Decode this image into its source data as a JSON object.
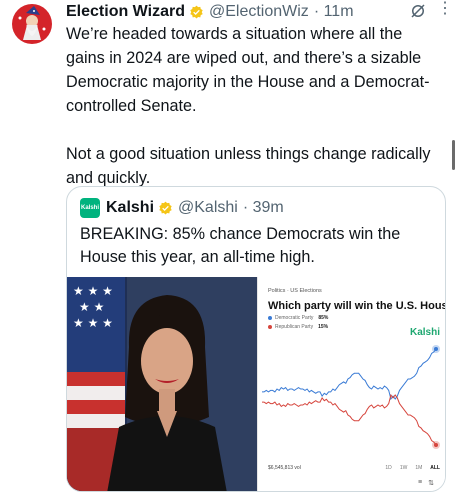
{
  "author": {
    "name": "Election Wizard",
    "handle": "@ElectionWiz",
    "time": "· 11m",
    "avatar_color": "#d4242a"
  },
  "tweet": {
    "text": "We’re headed towards a situation where all the gains in 2024 are wiped out, and there’s a sizable Democratic majority in the House and a Democrat-controlled Senate.\n\nNot a good situation unless things change radically and quickly."
  },
  "quote": {
    "name": "Kalshi",
    "handle": "@Kalshi",
    "time": "· 39m",
    "logo_text": "Kalshi",
    "text": "BREAKING: 85% chance Democrats win the House this year, an all-time high.",
    "chart": {
      "breadcrumb": "Politics · US Elections",
      "title": "Which party will win the U.S. House?",
      "brand": "Kalshi",
      "legend": [
        {
          "label": "Democratic Party",
          "value": "85%",
          "color": "#3a7bd5"
        },
        {
          "label": "Republican Party",
          "value": "15%",
          "color": "#d6453d"
        }
      ],
      "volume": "$6,545,813 vol",
      "ranges": [
        "1D",
        "1W",
        "1M",
        "ALL"
      ],
      "selected_range": "ALL"
    }
  },
  "colors": {
    "verified": "#f5c518",
    "kalshi_green": "#00b37e",
    "dem": "#3a7bd5",
    "rep": "#d6453d"
  },
  "chart_data": {
    "type": "line",
    "title": "Which party will win the U.S. House?",
    "series": [
      {
        "name": "Democratic Party",
        "values": [
          55,
          55,
          56,
          55,
          56,
          56,
          55,
          57,
          56,
          58,
          57,
          58,
          56,
          57,
          57,
          56,
          57,
          58,
          57,
          57,
          56,
          57,
          55,
          56,
          55,
          54,
          55,
          55,
          52,
          54,
          53,
          55,
          55,
          57,
          56,
          58,
          60,
          61,
          62,
          61,
          64,
          65,
          67,
          68,
          68,
          68,
          66,
          64,
          63,
          60,
          58,
          57,
          59,
          58,
          57,
          58,
          57,
          59,
          58,
          56,
          50,
          52,
          50,
          52,
          56,
          58,
          60,
          62,
          64,
          64,
          65,
          66,
          68,
          72,
          73,
          75,
          76,
          77,
          79,
          82,
          83,
          85
        ]
      },
      {
        "name": "Republican Party",
        "values": [
          45,
          45,
          44,
          45,
          44,
          44,
          45,
          43,
          44,
          42,
          43,
          42,
          44,
          43,
          43,
          44,
          43,
          42,
          43,
          43,
          44,
          43,
          45,
          44,
          45,
          46,
          45,
          45,
          48,
          46,
          47,
          45,
          45,
          43,
          44,
          42,
          40,
          39,
          38,
          39,
          36,
          35,
          33,
          32,
          32,
          32,
          34,
          36,
          37,
          40,
          42,
          43,
          41,
          42,
          43,
          42,
          43,
          41,
          42,
          44,
          50,
          48,
          50,
          48,
          44,
          42,
          40,
          38,
          36,
          36,
          35,
          34,
          32,
          28,
          27,
          25,
          24,
          23,
          21,
          18,
          17,
          15
        ]
      }
    ]
  }
}
